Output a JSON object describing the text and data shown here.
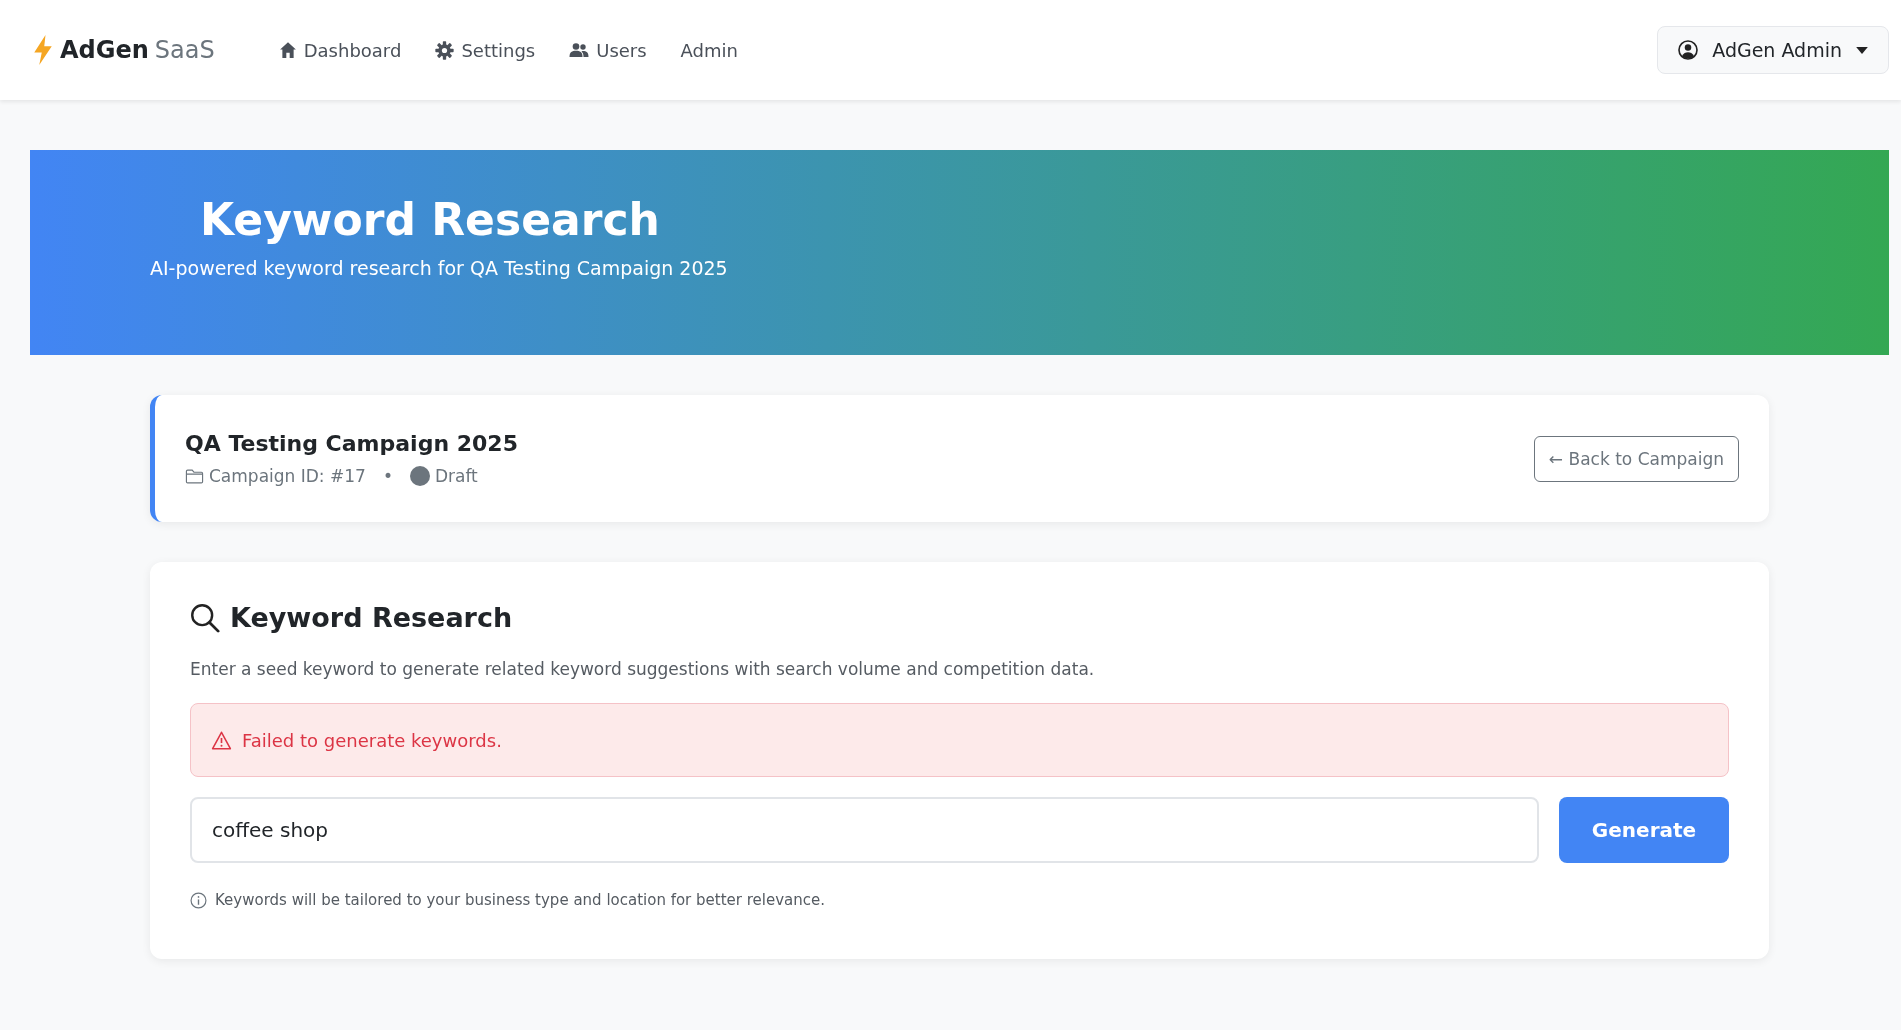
{
  "brand": {
    "name": "AdGen",
    "suffix": "SaaS"
  },
  "nav": [
    {
      "label": "Dashboard"
    },
    {
      "label": "Settings"
    },
    {
      "label": "Users"
    },
    {
      "label": "Admin"
    }
  ],
  "user_menu": {
    "label": "AdGen Admin"
  },
  "hero": {
    "title": "Keyword Research",
    "subtitle": "AI-powered keyword research for QA Testing Campaign 2025"
  },
  "campaign": {
    "name": "QA Testing Campaign 2025",
    "id_label": "Campaign ID: #17",
    "separator": "•",
    "status": "Draft",
    "back_button": "← Back to Campaign"
  },
  "research": {
    "title": "Keyword Research",
    "description": "Enter a seed keyword to generate related keyword suggestions with search volume and competition data.",
    "error": "Failed to generate keywords.",
    "input_value": "coffee shop",
    "button": "Generate",
    "hint": "Keywords will be tailored to your business type and location for better relevance."
  }
}
